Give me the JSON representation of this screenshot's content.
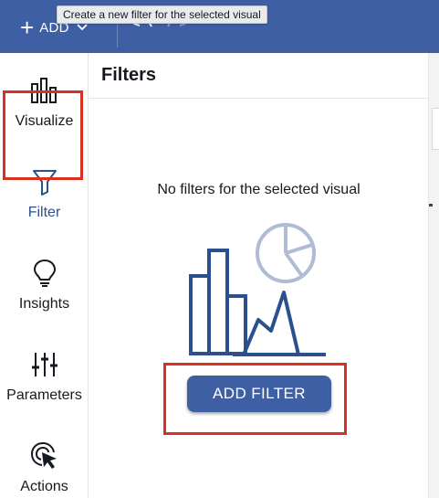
{
  "toolbar": {
    "add_label": "ADD",
    "tooltip": "Create a new filter for the selected visual"
  },
  "sidebar": {
    "items": [
      {
        "label": "Visualize",
        "icon": "bar-chart-icon"
      },
      {
        "label": "Filter",
        "icon": "funnel-icon",
        "active": true
      },
      {
        "label": "Insights",
        "icon": "lightbulb-icon"
      },
      {
        "label": "Parameters",
        "icon": "sliders-icon"
      },
      {
        "label": "Actions",
        "icon": "cursor-click-icon"
      }
    ]
  },
  "filters_panel": {
    "title": "Filters",
    "empty_message": "No filters for the selected visual",
    "add_filter_label": "ADD FILTER"
  },
  "colors": {
    "brand": "#3e5fa3",
    "highlight": "#d9301f",
    "illustration_dark": "#2b4f8f",
    "illustration_light": "#b0bcd3"
  }
}
